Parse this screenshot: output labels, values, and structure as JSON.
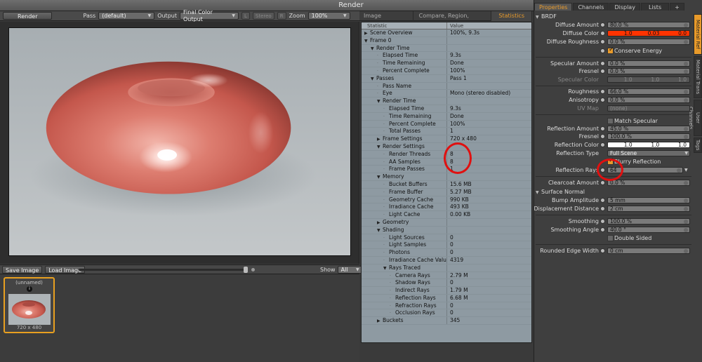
{
  "window": {
    "title": "Render"
  },
  "toolbar": {
    "render_button": "Render",
    "pass_label": "Pass",
    "pass_value": "(default)",
    "output_label": "Output",
    "output_value": "Final Color Output",
    "l_label": "L",
    "stereo_label": "Stereo",
    "stereo_value": "R",
    "zoom_label": "Zoom",
    "zoom_value": "100%"
  },
  "image_bar": {
    "save": "Save Image",
    "load": "Load Image",
    "show_label": "Show",
    "show_value": "All"
  },
  "thumbnail": {
    "name": "(unnamed)",
    "size": "720 x 480"
  },
  "mid_tabs": [
    "Image Processing",
    "Compare, Region, Options",
    "Statistics"
  ],
  "stats": {
    "headers": {
      "statistic": "Statistic",
      "value": "Value"
    },
    "rows": [
      {
        "name": "Scene Overview",
        "value": "100%, 9.3s"
      },
      {
        "name": "Frame 0",
        "value": ""
      },
      {
        "name": "Render Time",
        "value": ""
      },
      {
        "name": "Elapsed Time",
        "value": "9.3s"
      },
      {
        "name": "Time Remaining",
        "value": "Done"
      },
      {
        "name": "Percent Complete",
        "value": "100%"
      },
      {
        "name": "Passes",
        "value": "Pass 1"
      },
      {
        "name": "Pass Name",
        "value": ""
      },
      {
        "name": "Eye",
        "value": "Mono (stereo disabled)"
      },
      {
        "name": "Render Time",
        "value": ""
      },
      {
        "name": "Elapsed Time",
        "value": "9.3s"
      },
      {
        "name": "Time Remaining",
        "value": "Done"
      },
      {
        "name": "Percent Complete",
        "value": "100%"
      },
      {
        "name": "Total Passes",
        "value": "1"
      },
      {
        "name": "Frame Settings",
        "value": "720 x 480"
      },
      {
        "name": "Render Settings",
        "value": ""
      },
      {
        "name": "Render Threads",
        "value": "8"
      },
      {
        "name": "AA Samples",
        "value": "8"
      },
      {
        "name": "Frame Passes",
        "value": "1"
      },
      {
        "name": "Memory",
        "value": ""
      },
      {
        "name": "Bucket Buffers",
        "value": "15.6 MB"
      },
      {
        "name": "Frame Buffer",
        "value": "5.27 MB"
      },
      {
        "name": "Geometry Cache",
        "value": "990 KB"
      },
      {
        "name": "Irradiance Cache",
        "value": "493 KB"
      },
      {
        "name": "Light Cache",
        "value": "0.00 KB"
      },
      {
        "name": "Geometry",
        "value": ""
      },
      {
        "name": "Shading",
        "value": ""
      },
      {
        "name": "Light Sources",
        "value": "0"
      },
      {
        "name": "Light Samples",
        "value": "0"
      },
      {
        "name": "Photons",
        "value": "0"
      },
      {
        "name": "Irradiance Cache Values",
        "value": "4319"
      },
      {
        "name": "Rays Traced",
        "value": ""
      },
      {
        "name": "Camera Rays",
        "value": "2.79 M"
      },
      {
        "name": "Shadow Rays",
        "value": "0"
      },
      {
        "name": "Indirect Rays",
        "value": "1.79 M"
      },
      {
        "name": "Reflection Rays",
        "value": "6.68 M"
      },
      {
        "name": "Refraction Rays",
        "value": "0"
      },
      {
        "name": "Occlusion Rays",
        "value": "0"
      },
      {
        "name": "Buckets",
        "value": "345"
      }
    ]
  },
  "right_tabs": [
    "Properties",
    "Channels",
    "Display",
    "Lists",
    "+"
  ],
  "vertical_tabs": [
    "Material Ref",
    "Material Trans",
    "User Channels",
    "Tags"
  ],
  "props": {
    "brdf": "BRDF",
    "diffuse_amount": {
      "label": "Diffuse Amount",
      "value": "80.0 %"
    },
    "diffuse_color": {
      "label": "Diffuse Color",
      "r": "1.0",
      "g": "0.03",
      "b": "0.0",
      "color": "#ff3300"
    },
    "diffuse_roughness": {
      "label": "Diffuse Roughness",
      "value": "0.0 %"
    },
    "conserve_energy": "Conserve Energy",
    "specular_amount": {
      "label": "Specular Amount",
      "value": "0.0 %"
    },
    "fresnel1": {
      "label": "Fresnel",
      "value": "0.0 %"
    },
    "specular_color": {
      "label": "Specular Color",
      "r": "1.0",
      "g": "1.0",
      "b": "1.0"
    },
    "roughness": {
      "label": "Roughness",
      "value": "66.0 %"
    },
    "anisotropy": {
      "label": "Anisotropy",
      "value": "0.0 %"
    },
    "uv_map": {
      "label": "UV Map",
      "value": "(none)"
    },
    "match_specular": "Match Specular",
    "reflection_amount": {
      "label": "Reflection Amount",
      "value": "45.0 %"
    },
    "fresnel2": {
      "label": "Fresnel",
      "value": "100.0 %"
    },
    "reflection_color": {
      "label": "Reflection Color",
      "r": "1.0",
      "g": "1.0",
      "b": "1.0"
    },
    "reflection_type": {
      "label": "Reflection Type",
      "value": "Full Scene"
    },
    "blurry_reflection": "Blurry Reflection",
    "reflection_rays": {
      "label": "Reflection Rays",
      "value": "64"
    },
    "clearcoat_amount": {
      "label": "Clearcoat Amount",
      "value": "0.0 %"
    },
    "surface_normal": "Surface Normal",
    "bump_amplitude": {
      "label": "Bump Amplitude",
      "value": "5 mm"
    },
    "displacement_distance": {
      "label": "Displacement Distance",
      "value": "2 cm"
    },
    "smoothing": {
      "label": "Smoothing",
      "value": "100.0 %"
    },
    "smoothing_angle": {
      "label": "Smoothing Angle",
      "value": "40.0 °"
    },
    "double_sided": "Double Sided",
    "rounded_edge_width": {
      "label": "Rounded Edge Width",
      "value": "0 cm"
    }
  }
}
